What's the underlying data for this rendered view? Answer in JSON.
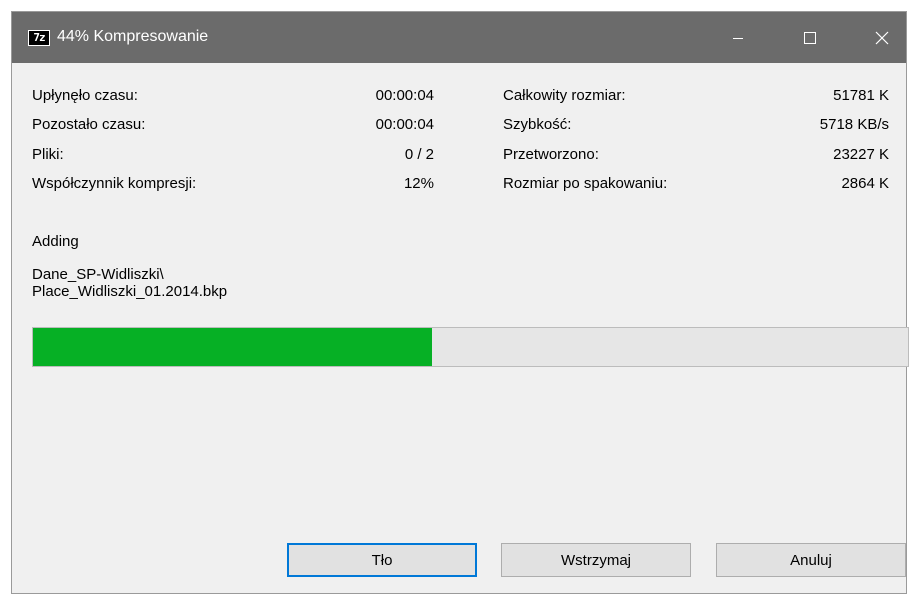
{
  "window": {
    "title": "44% Kompresowanie",
    "icon": "7z-app-icon",
    "icon_text": "7z"
  },
  "stats_left": [
    {
      "label": "Upłynęło czasu:",
      "value": "00:00:04"
    },
    {
      "label": "Pozostało czasu:",
      "value": "00:00:04"
    },
    {
      "label": "Pliki:",
      "value": "0 / 2"
    },
    {
      "label": "Współczynnik kompresji:",
      "value": "12%"
    }
  ],
  "stats_right": [
    {
      "label": "Całkowity rozmiar:",
      "value": "51781 K"
    },
    {
      "label": "Szybkość:",
      "value": "5718 KB/s"
    },
    {
      "label": "Przetworzono:",
      "value": "23227 K"
    },
    {
      "label": "Rozmiar po spakowaniu:",
      "value": "2864 K"
    }
  ],
  "operation": "Adding",
  "current_file": "Dane_SP-Widliszki\\\nPlace_Widliszki_01.2014.bkp",
  "progress": {
    "percent": 44,
    "color": "#06b025"
  },
  "buttons": {
    "background": "Tło",
    "pause": "Wstrzymaj",
    "cancel": "Anuluj"
  },
  "colors": {
    "titlebar": "#6b6b6b",
    "accent": "#0078d7"
  }
}
